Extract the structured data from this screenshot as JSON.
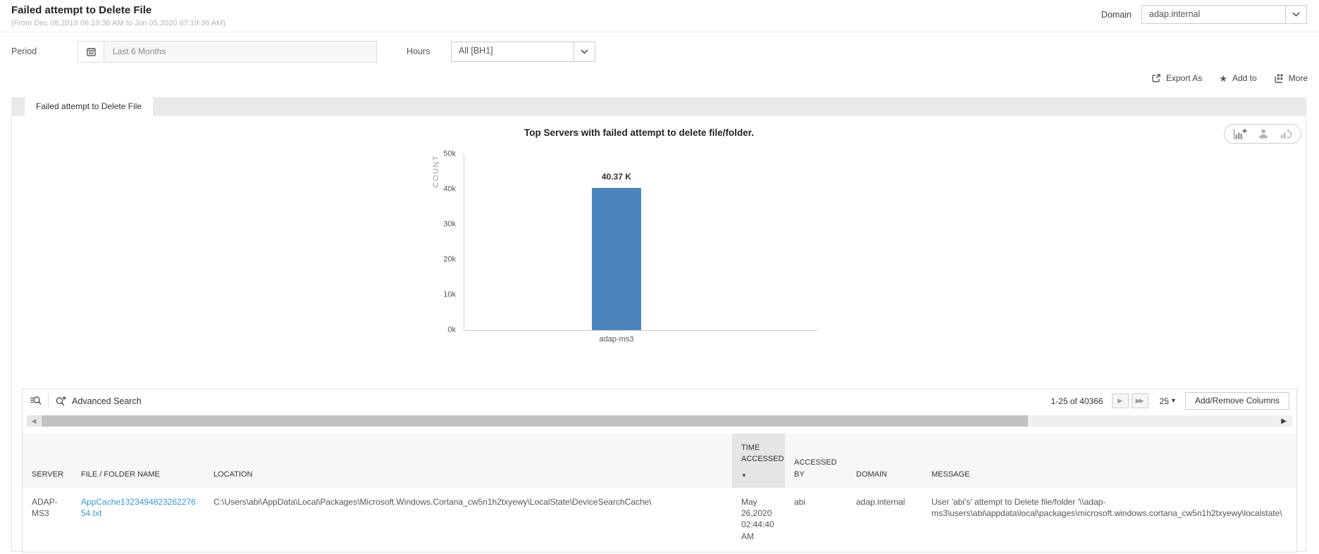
{
  "header": {
    "title": "Failed attempt to Delete File",
    "subtitle": "(From Dec 08,2019 06:19:36 AM to Jun 05,2020 07:19:36 AM)",
    "domain_label": "Domain",
    "domain_value": "adap.internal"
  },
  "filters": {
    "period_label": "Period",
    "period_value": "Last 6 Months",
    "hours_label": "Hours",
    "hours_value": "All [BH1]"
  },
  "actions": {
    "export_as": "Export As",
    "add_to": "Add to",
    "more": "More"
  },
  "tab": {
    "label": "Failed attempt to Delete File"
  },
  "chart_data": {
    "type": "bar",
    "title": "Top Servers with failed attempt to delete file/folder.",
    "categories": [
      "adap-ms3"
    ],
    "values": [
      40370
    ],
    "value_labels": [
      "40.37 K"
    ],
    "xlabel": "",
    "ylabel": "COUNT",
    "ylim": [
      0,
      50000
    ],
    "yticks": [
      "0k",
      "10k",
      "20k",
      "30k",
      "40k",
      "50k"
    ],
    "grid": false,
    "legend": false,
    "bar_color": "#4b85be"
  },
  "table": {
    "toolbar": {
      "advanced_search": "Advanced Search",
      "range": "1-25 of 40366",
      "page_size": "25",
      "add_remove_columns": "Add/Remove Columns"
    },
    "columns": [
      "SERVER",
      "FILE / FOLDER NAME",
      "LOCATION",
      "TIME ACCESSED",
      "ACCESSED BY",
      "DOMAIN",
      "MESSAGE"
    ],
    "sort": {
      "column": "TIME ACCESSED",
      "direction": "desc"
    },
    "rows": [
      {
        "server": "ADAP-MS3",
        "file_name": "AppCache132349482326227654.txt",
        "location": "C:\\Users\\abi\\AppData\\Local\\Packages\\Microsoft.Windows.Cortana_cw5n1h2txyewy\\LocalState\\DeviceSearchCache\\",
        "time_accessed": "May 26,2020 02:44:40 AM",
        "accessed_by": "abi",
        "domain": "adap.internal",
        "message": "User 'abi's' attempt to Delete file/folder '\\\\adap-ms3\\users\\abi\\appdata\\local\\packages\\microsoft.windows.cortana_cw5n1h2txyewy\\localstate\\"
      }
    ]
  },
  "icons": {
    "star": "★",
    "caret_down": "▾",
    "sort_desc": "▼",
    "page_next": "▶",
    "page_last": "▶▶",
    "scroll_left": "◀",
    "scroll_right": "▶"
  },
  "colors": {
    "bar": "#4b85be",
    "link": "#3699d6"
  }
}
